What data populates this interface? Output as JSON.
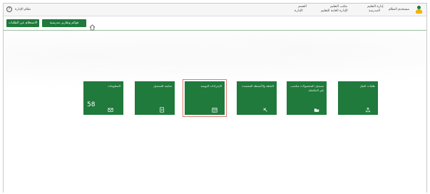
{
  "header": {
    "user_name": "مستخدم النظام",
    "org_line1": "إدارة التعليم",
    "org_line2": "المدرسة",
    "office_line1": "مكتب التعليم",
    "office_line2": "الإدارة العامة للتعليم",
    "dept_line1": "القسم",
    "dept_line2": "الإدارة",
    "system_name": "نظام الإدارة"
  },
  "toolbar": {
    "btn_forms": "قوائم وتقارير مدرسية",
    "btn_requests": "الاستعلام عن الطلبات"
  },
  "tiles": [
    {
      "label": "طلبات النقل",
      "count": "",
      "icon": "transfer-icon"
    },
    {
      "label": "تسجيل المحصولات مناسب غير المكتملة",
      "count": "",
      "icon": "folder-icon"
    },
    {
      "label": "الخطة والأنشطة المعتمدة",
      "count": "",
      "icon": "tools-icon"
    },
    {
      "label": "الإجراءات اليومية",
      "count": "",
      "icon": "calendar-icon"
    },
    {
      "label": "متابعة التسجيل",
      "count": "",
      "icon": "document-icon"
    },
    {
      "label": "المعلومات",
      "count": "58",
      "icon": "mail-icon"
    }
  ],
  "colors": {
    "primary": "#1f7a3c",
    "selected_outline": "#e07a70"
  }
}
